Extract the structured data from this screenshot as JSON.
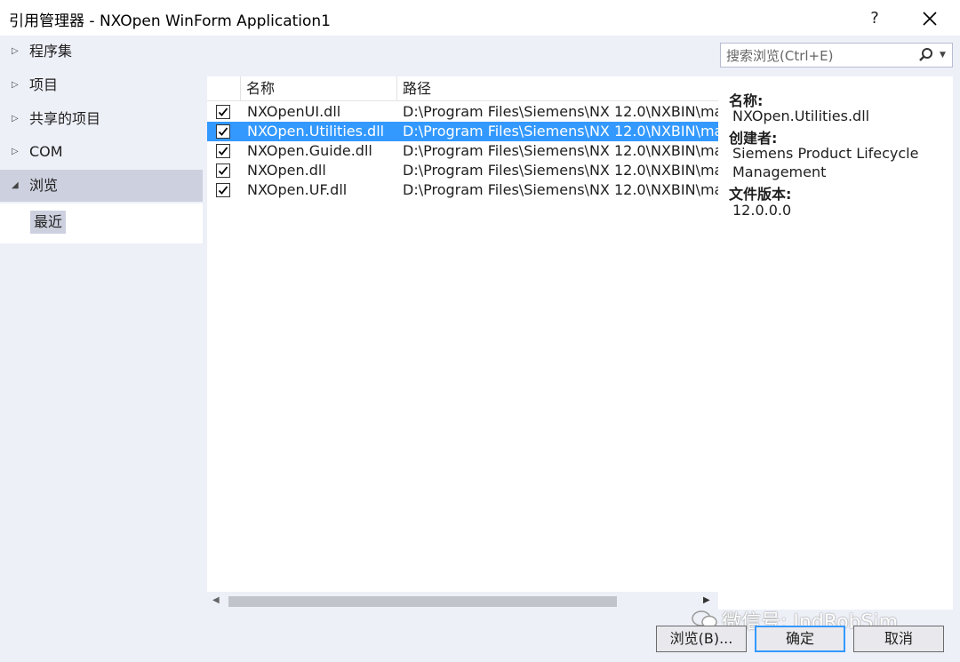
{
  "window": {
    "title": "引用管理器 - NXOpen WinForm Application1",
    "help_glyph": "?"
  },
  "nav": {
    "items": [
      {
        "label": "程序集",
        "expanded": false
      },
      {
        "label": "项目",
        "expanded": false
      },
      {
        "label": "共享的项目",
        "expanded": false
      },
      {
        "label": "COM",
        "expanded": false
      },
      {
        "label": "浏览",
        "expanded": true,
        "selected": true
      }
    ],
    "sub_item": "最近"
  },
  "search": {
    "placeholder": "搜索浏览(Ctrl+E)"
  },
  "list": {
    "columns": [
      "名称",
      "路径"
    ],
    "rows": [
      {
        "checked": true,
        "name": "NXOpenUI.dll",
        "path": "D:\\Program Files\\Siemens\\NX 12.0\\NXBIN\\ma",
        "selected": false
      },
      {
        "checked": true,
        "name": "NXOpen.Utilities.dll",
        "path": "D:\\Program Files\\Siemens\\NX 12.0\\NXBIN\\ma",
        "selected": true
      },
      {
        "checked": true,
        "name": "NXOpen.Guide.dll",
        "path": "D:\\Program Files\\Siemens\\NX 12.0\\NXBIN\\ma",
        "selected": false
      },
      {
        "checked": true,
        "name": "NXOpen.dll",
        "path": "D:\\Program Files\\Siemens\\NX 12.0\\NXBIN\\ma",
        "selected": false
      },
      {
        "checked": true,
        "name": "NXOpen.UF.dll",
        "path": "D:\\Program Files\\Siemens\\NX 12.0\\NXBIN\\ma",
        "selected": false
      }
    ]
  },
  "details": {
    "name_label": "名称:",
    "name_value": "NXOpen.Utilities.dll",
    "creator_label": "创建者:",
    "creator_value": "Siemens Product Lifecycle Management",
    "version_label": "文件版本:",
    "version_value": "12.0.0.0"
  },
  "buttons": {
    "browse": "浏览(B)...",
    "ok": "确定",
    "cancel": "取消"
  },
  "watermark": "微信号: IndRobSim",
  "colors": {
    "selection": "#3399ff",
    "nav_selected": "#cdd0de",
    "background": "#eef0f8"
  }
}
